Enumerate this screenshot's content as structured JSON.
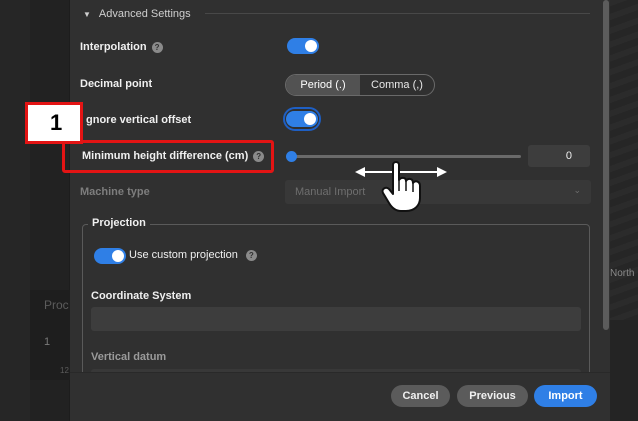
{
  "background": {
    "left_text": "Proc",
    "left_number": "1",
    "left_small": "12",
    "right_text": "North"
  },
  "advanced": {
    "title": "Advanced Settings",
    "interpolation_label": "Interpolation",
    "interpolation_on": true,
    "decimal_label": "Decimal point",
    "decimal_options": [
      "Period (.)",
      "Comma (,)"
    ],
    "decimal_selected": "Period (.)",
    "vertical_offset_label": "gnore vertical offset",
    "vertical_offset_on": true,
    "min_height_label": "Minimum height difference (cm)",
    "min_height_value": "0",
    "slider_level": 0,
    "machine_label": "Machine type",
    "machine_value": "Manual Import"
  },
  "projection": {
    "title": "Projection",
    "use_custom_label": "Use custom projection",
    "use_custom_on": true,
    "coordinate_label": "Coordinate System",
    "coordinate_value": "",
    "vertical_datum_label": "Vertical datum"
  },
  "footer": {
    "cancel": "Cancel",
    "previous": "Previous",
    "import": "Import"
  },
  "annotation": {
    "step_number": "1"
  },
  "colors": {
    "accent": "#2f7fe6",
    "annotation_red": "#e31414"
  }
}
